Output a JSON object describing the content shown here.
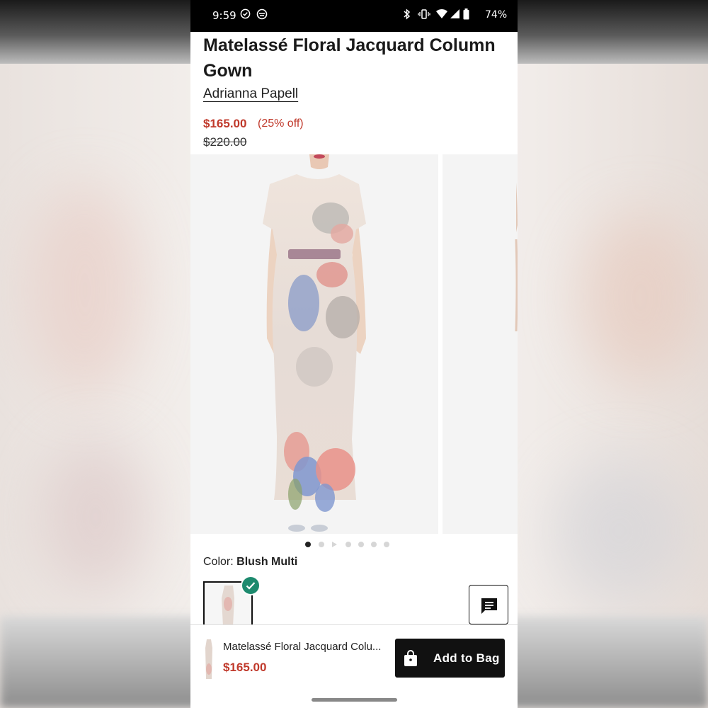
{
  "status_bar": {
    "time": "9:59",
    "battery": "74%"
  },
  "product": {
    "title": "Matelassé Floral Jacquard Column Gown",
    "brand": "Adrianna Papell",
    "sale_price": "$165.00",
    "discount": "(25% off)",
    "original_price": "$220.00"
  },
  "gallery": {
    "slide_count": 7,
    "active_index": 0
  },
  "color": {
    "label": "Color:",
    "value": "Blush Multi"
  },
  "bottom_bar": {
    "product_name": "Matelassé Floral Jacquard Colu...",
    "price": "$165.00",
    "add_to_bag_label": "Add to Bag"
  },
  "icons": {
    "chat": "chat-icon",
    "bag": "shopping-bag-icon",
    "check": "check-icon"
  },
  "colors": {
    "sale": "#c0392b",
    "check": "#1d8a6e",
    "button": "#111111"
  }
}
